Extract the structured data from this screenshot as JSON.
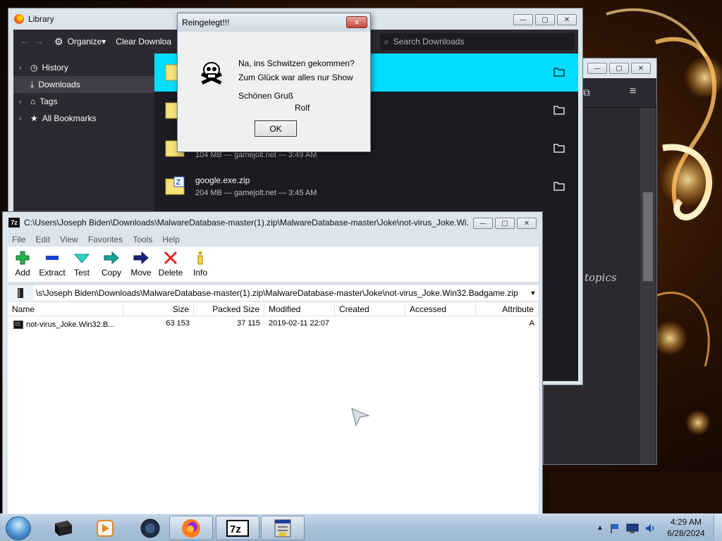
{
  "library": {
    "title": "Library",
    "organize_label": "Organize",
    "clear_label": "Clear Downloa",
    "search_placeholder": "Search Downloads",
    "sidebar": [
      {
        "label": "History"
      },
      {
        "label": "Downloads"
      },
      {
        "label": "Tags"
      },
      {
        "label": "All Bookmarks"
      }
    ],
    "downloads": [
      {
        "name": "",
        "meta": ""
      },
      {
        "name": "",
        "meta": ""
      },
      {
        "name": "",
        "meta": "104 MB — gamejolt.net — 3:49 AM"
      },
      {
        "name": "google.exe.zip",
        "meta": "204 MB — gamejolt.net — 3:45 AM"
      }
    ]
  },
  "background_window": {
    "visible_text": "topics"
  },
  "messagebox": {
    "title": "Reingelegt!!!",
    "close_label": "×",
    "line1": "Na, ins Schwitzen gekommen?",
    "line2": "Zum Glück war alles nur Show",
    "line3": "Schönen Gruß",
    "line4": "Rolf",
    "ok_label": "OK"
  },
  "sevenzip": {
    "title": "C:\\Users\\Joseph Biden\\Downloads\\MalwareDatabase-master(1).zip\\MalwareDatabase-master\\Joke\\not-virus_Joke.Wi...",
    "menu": [
      "File",
      "Edit",
      "View",
      "Favorites",
      "Tools",
      "Help"
    ],
    "toolbar": [
      {
        "label": "Add",
        "icon": "add-icon"
      },
      {
        "label": "Extract",
        "icon": "extract-icon"
      },
      {
        "label": "Test",
        "icon": "test-icon"
      },
      {
        "label": "Copy",
        "icon": "copy-icon"
      },
      {
        "label": "Move",
        "icon": "move-icon"
      },
      {
        "label": "Delete",
        "icon": "delete-icon"
      },
      {
        "label": "Info",
        "icon": "info-icon"
      }
    ],
    "address": "s\\Joseph Biden\\Downloads\\MalwareDatabase-master(1).zip\\MalwareDatabase-master\\Joke\\not-virus_Joke.Win32.Badgame.zip\\",
    "columns": [
      "Name",
      "Size",
      "Packed Size",
      "Modified",
      "Created",
      "Accessed",
      "Attribute"
    ],
    "rows": [
      {
        "name": "not-virus_Joke.Win32.B...",
        "size": "63 153",
        "packed": "37 115",
        "modified": "2019-02-11 22:07",
        "created": "",
        "accessed": "",
        "attr": "A"
      }
    ]
  },
  "taskbar": {
    "time": "4:29 AM",
    "date": "6/28/2024",
    "apps": [
      "start-orb",
      "cmd-icon",
      "media-player-icon",
      "browser-icon",
      "firefox-icon",
      "7zip-icon",
      "program-icon"
    ]
  },
  "colors": {
    "selection_cyan": "#00ddff",
    "firefox_dark": "#1c1b22",
    "taskbar": "#a9c1d9"
  }
}
